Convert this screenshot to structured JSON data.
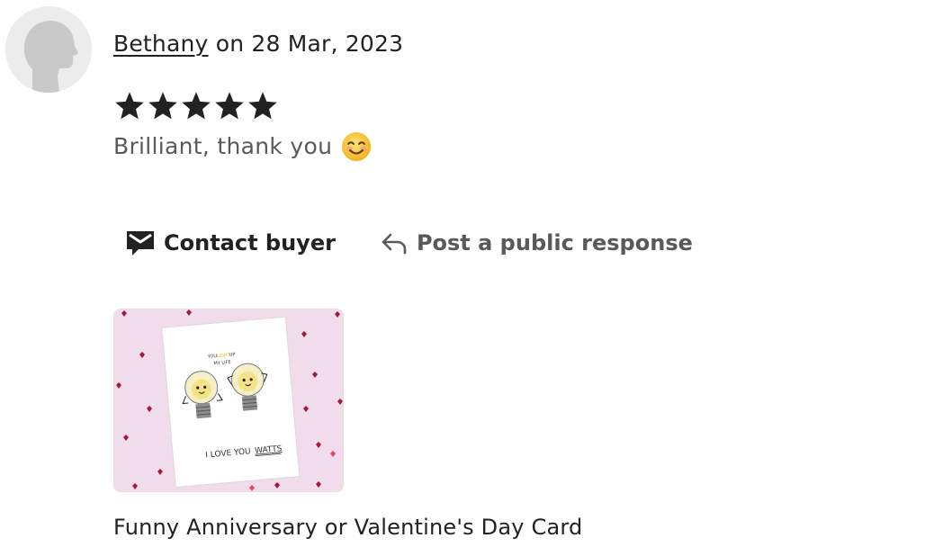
{
  "review": {
    "reviewer_name": "Bethany",
    "date_prefix": " on ",
    "date": "28 Mar, 2023",
    "rating": 5,
    "text": "Brilliant, thank you",
    "emoji": "smiling-face-emoji"
  },
  "actions": {
    "contact_label": "Contact buyer",
    "respond_label": "Post a public response"
  },
  "listing": {
    "title": "Funny Anniversary or Valentine's Day Card",
    "card_top_text_1": "YOU",
    "card_top_text_2": "LIGHT",
    "card_top_text_3": "UP",
    "card_top_text_4": "MY LIFE",
    "card_bottom_text_1": "I LOVE YOU",
    "card_bottom_text_2": "WATTS"
  },
  "icons": {
    "avatar": "default-user-avatar",
    "star": "star-icon",
    "contact": "envelope-icon",
    "respond": "reply-arrow-icon"
  },
  "colors": {
    "text_primary": "#222222",
    "text_secondary": "#595959",
    "star": "#222222",
    "card_bg": "#f1dceb",
    "heart": "#a3183a"
  }
}
